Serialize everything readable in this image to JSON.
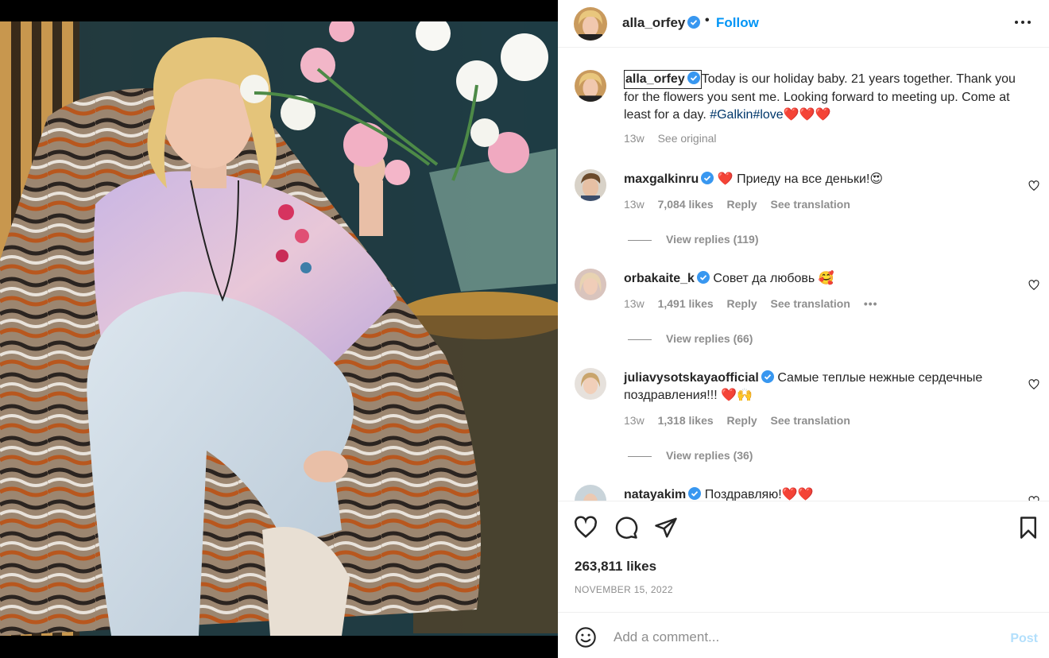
{
  "header": {
    "username": "alla_orfey",
    "separator": "•",
    "follow_label": "Follow",
    "more_icon": "more-horizontal-icon"
  },
  "caption": {
    "username": "alla_orfey",
    "text": "Today is our holiday baby. 21 years together. Thank you for the flowers you sent me. Looking forward to meeting up. Come at least for a day. ",
    "hashtags": "#Galkin#love",
    "emoji_tail": "❤️❤️❤️",
    "time": "13w",
    "see_original": "See original"
  },
  "comments": [
    {
      "username": "maxgalkinru",
      "text": "❤️ Приеду на все деньки!😍",
      "time": "13w",
      "likes": "7,084 likes",
      "reply": "Reply",
      "translate": "See translation",
      "view_replies": "View replies (119)"
    },
    {
      "username": "orbakaite_k",
      "text": "Совет да любовь 🥰",
      "time": "13w",
      "likes": "1,491 likes",
      "reply": "Reply",
      "translate": "See translation",
      "more": "•••",
      "view_replies": "View replies (66)"
    },
    {
      "username": "juliavysotskayaofficial",
      "text": "Самые теплые нежные сердечные поздравления!!! ❤️🙌",
      "time": "13w",
      "likes": "1,318 likes",
      "reply": "Reply",
      "translate": "See translation",
      "view_replies": "View replies (36)"
    },
    {
      "username": "natayakim",
      "text": "Поздравляю!❤️❤️"
    }
  ],
  "actions": {
    "like_icon": "heart-icon",
    "comment_icon": "comment-icon",
    "share_icon": "share-icon",
    "save_icon": "bookmark-icon"
  },
  "likes_count": "263,811 likes",
  "post_date": "NOVEMBER 15, 2022",
  "comment_box": {
    "placeholder": "Add a comment...",
    "post_label": "Post",
    "emoji_icon": "emoji-icon"
  },
  "colors": {
    "accent": "#0095f6",
    "hashtag": "#00376b",
    "muted": "#8e8e8e",
    "post_disabled": "#b2dffc",
    "verified": "#3897f0",
    "heart_red": "#ed4956"
  }
}
